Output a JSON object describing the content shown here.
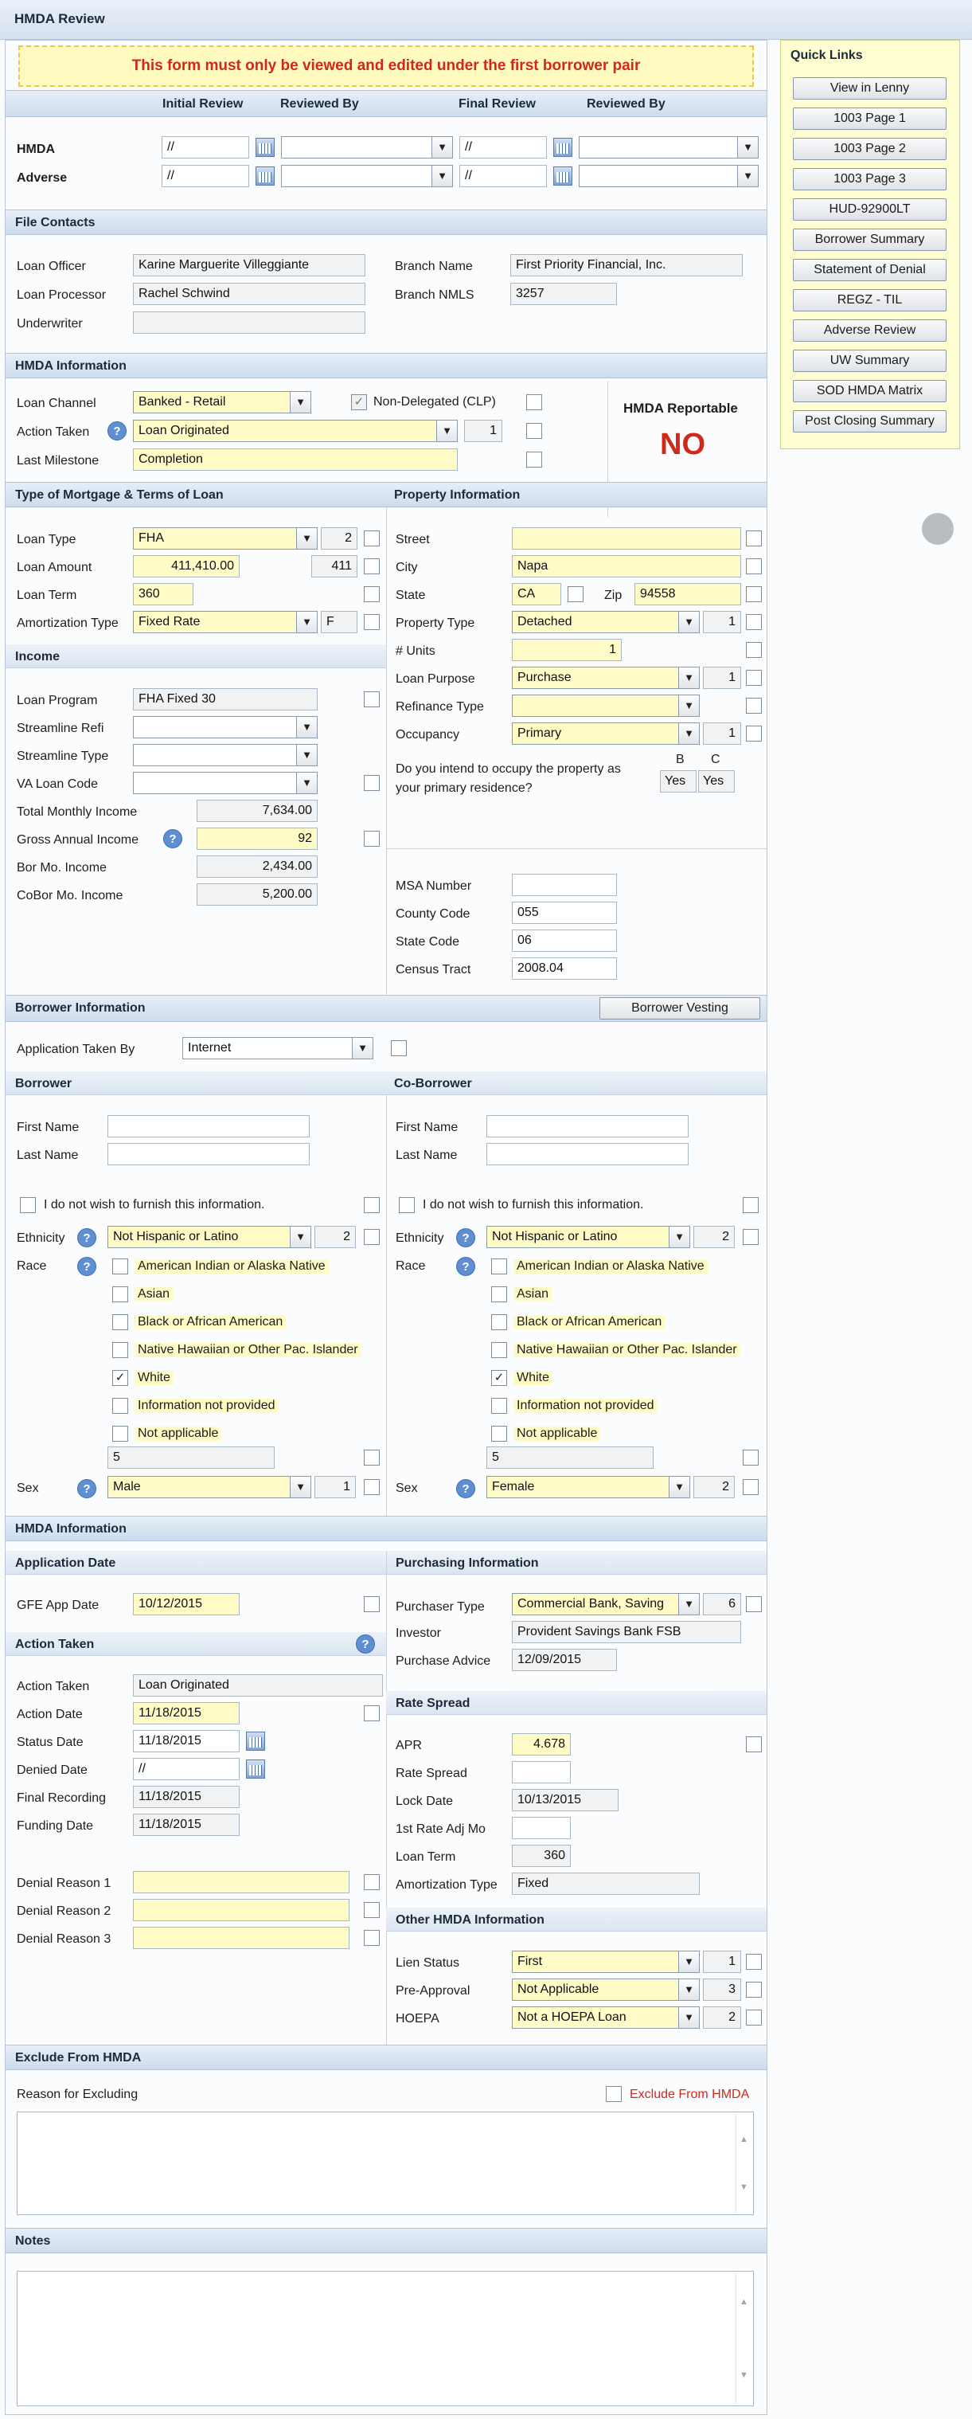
{
  "window": {
    "title": "HMDA Review"
  },
  "warning": "This form must only be viewed and edited under the first borrower pair",
  "review": {
    "initial_review": "Initial Review",
    "reviewed_by": "Reviewed By",
    "final_review": "Final Review",
    "reviewed_by2": "Reviewed By",
    "hmda_label": "HMDA",
    "adverse_label": "Adverse",
    "date_placeholder": "//"
  },
  "file_contacts": {
    "title": "File Contacts",
    "loan_officer_label": "Loan Officer",
    "loan_officer": "Karine Marguerite Villeggiante",
    "loan_processor_label": "Loan Processor",
    "loan_processor": "Rachel Schwind",
    "underwriter_label": "Underwriter",
    "underwriter": "",
    "branch_name_label": "Branch Name",
    "branch_name": "First Priority Financial, Inc.",
    "branch_nmls_label": "Branch NMLS",
    "branch_nmls": "3257"
  },
  "hmda_info": {
    "title": "HMDA Information",
    "loan_channel_label": "Loan Channel",
    "loan_channel": "Banked - Retail",
    "non_delegated": "Non-Delegated (CLP)",
    "action_taken_label": "Action Taken",
    "action_taken": "Loan Originated",
    "action_code": "1",
    "last_milestone_label": "Last Milestone",
    "last_milestone": "Completion",
    "reportable_label": "HMDA Reportable",
    "reportable_value": "NO"
  },
  "mortgage": {
    "title": "Type of Mortgage & Terms of Loan",
    "loan_type_label": "Loan Type",
    "loan_type": "FHA",
    "loan_type_code": "2",
    "loan_amount_label": "Loan Amount",
    "loan_amount": "411,410.00",
    "loan_amount_k": "411",
    "loan_term_label": "Loan Term",
    "loan_term": "360",
    "amort_label": "Amortization Type",
    "amort": "Fixed Rate",
    "amort_code": "F"
  },
  "income": {
    "title": "Income",
    "loan_program_label": "Loan Program",
    "loan_program": "FHA Fixed 30",
    "streamline_refi_label": "Streamline Refi",
    "streamline_type_label": "Streamline Type",
    "va_loan_code_label": "VA Loan Code",
    "total_monthly_label": "Total Monthly Income",
    "total_monthly": "7,634.00",
    "gross_annual_label": "Gross Annual Income",
    "gross_annual": "92",
    "bor_mo_label": "Bor Mo. Income",
    "bor_mo": "2,434.00",
    "cobor_mo_label": "CoBor Mo. Income",
    "cobor_mo": "5,200.00"
  },
  "property": {
    "title": "Property Information",
    "street_label": "Street",
    "street": "",
    "city_label": "City",
    "city": "Napa",
    "state_label": "State",
    "state": "CA",
    "zip_label": "Zip",
    "zip": "94558",
    "property_type_label": "Property Type",
    "property_type": "Detached",
    "property_type_code": "1",
    "units_label": "# Units",
    "units": "1",
    "loan_purpose_label": "Loan Purpose",
    "loan_purpose": "Purchase",
    "loan_purpose_code": "1",
    "refinance_type_label": "Refinance Type",
    "occupancy_label": "Occupancy",
    "occupancy": "Primary",
    "occupancy_code": "1",
    "intend_question": "Do you intend to occupy the property as your primary residence?",
    "col_b": "B",
    "col_c": "C",
    "ans_b": "Yes",
    "ans_c": "Yes",
    "msa_label": "MSA Number",
    "msa": "",
    "county_label": "County Code",
    "county": "055",
    "statecode_label": "State Code",
    "statecode": "06",
    "census_label": "Census Tract",
    "census": "2008.04"
  },
  "borrower_info": {
    "title": "Borrower Information",
    "vesting_button": "Borrower Vesting",
    "app_taken_label": "Application Taken By",
    "app_taken": "Internet"
  },
  "borrower": {
    "title": "Borrower",
    "first_label": "First Name",
    "last_label": "Last Name",
    "first": "",
    "last": "",
    "no_furnish": "I do not wish to furnish this information.",
    "ethnicity_label": "Ethnicity",
    "ethnicity": "Not Hispanic or Latino",
    "ethnicity_code": "2",
    "race_label": "Race",
    "races": [
      "American Indian or Alaska Native",
      "Asian",
      "Black or African American",
      "Native Hawaiian or Other Pac. Islander",
      "White",
      "Information not provided",
      "Not applicable"
    ],
    "race_code": "5",
    "sex_label": "Sex",
    "sex": "Male",
    "sex_code": "1"
  },
  "coborrower": {
    "title": "Co-Borrower",
    "first_label": "First Name",
    "last_label": "Last Name",
    "first": "",
    "last": "",
    "no_furnish": "I do not wish to furnish this information.",
    "ethnicity_label": "Ethnicity",
    "ethnicity": "Not Hispanic or Latino",
    "ethnicity_code": "2",
    "race_label": "Race",
    "races": [
      "American Indian or Alaska Native",
      "Asian",
      "Black or African American",
      "Native Hawaiian or Other Pac. Islander",
      "White",
      "Information not provided",
      "Not applicable"
    ],
    "race_code": "5",
    "sex_label": "Sex",
    "sex": "Female",
    "sex_code": "2"
  },
  "hmda2": {
    "title": "HMDA Information",
    "app_date_title": "Application Date",
    "gfe_label": "GFE App Date",
    "gfe": "10/12/2015",
    "action_taken_title": "Action Taken",
    "action_taken_label": "Action Taken",
    "action_taken": "Loan Originated",
    "action_date_label": "Action Date",
    "action_date": "11/18/2015",
    "status_date_label": "Status Date",
    "status_date": "11/18/2015",
    "denied_date_label": "Denied Date",
    "denied_date": "//",
    "final_recording_label": "Final Recording",
    "final_recording": "11/18/2015",
    "funding_date_label": "Funding Date",
    "funding_date": "11/18/2015",
    "denial1_label": "Denial Reason 1",
    "denial2_label": "Denial Reason 2",
    "denial3_label": "Denial Reason 3"
  },
  "purchasing": {
    "title": "Purchasing Information",
    "purchaser_type_label": "Purchaser Type",
    "purchaser_type": "Commercial Bank, Saving",
    "purchaser_code": "6",
    "investor_label": "Investor",
    "investor": "Provident Savings Bank FSB",
    "purchase_advice_label": "Purchase Advice",
    "purchase_advice": "12/09/2015"
  },
  "rate_spread": {
    "title": "Rate Spread",
    "apr_label": "APR",
    "apr": "4.678",
    "rate_spread_label": "Rate Spread",
    "lock_date_label": "Lock Date",
    "lock_date": "10/13/2015",
    "first_rate_label": "1st Rate Adj Mo",
    "loan_term_label": "Loan Term",
    "loan_term": "360",
    "amort_label": "Amortization Type",
    "amort": "Fixed"
  },
  "other_hmda": {
    "title": "Other HMDA Information",
    "lien_label": "Lien Status",
    "lien": "First",
    "lien_code": "1",
    "preapproval_label": "Pre-Approval",
    "preapproval": "Not Applicable",
    "preapproval_code": "3",
    "hoepa_label": "HOEPA",
    "hoepa": "Not a HOEPA Loan",
    "hoepa_code": "2"
  },
  "exclude": {
    "title": "Exclude From HMDA",
    "reason_label": "Reason for Excluding",
    "checkbox_label": "Exclude From HMDA"
  },
  "notes": {
    "title": "Notes"
  },
  "quick_links": {
    "title": "Quick Links",
    "items": [
      "View in Lenny",
      "1003 Page 1",
      "1003 Page 2",
      "1003 Page 3",
      "HUD-92900LT",
      "Borrower Summary",
      "Statement of Denial",
      "REGZ - TIL",
      "Adverse Review",
      "UW Summary",
      "SOD HMDA Matrix",
      "Post Closing Summary"
    ]
  },
  "colors": {
    "warning_text": "#d0281a",
    "reportable_no": "#d0281a",
    "required_field": "#fffbc6",
    "header_gradient": "#cddced"
  }
}
